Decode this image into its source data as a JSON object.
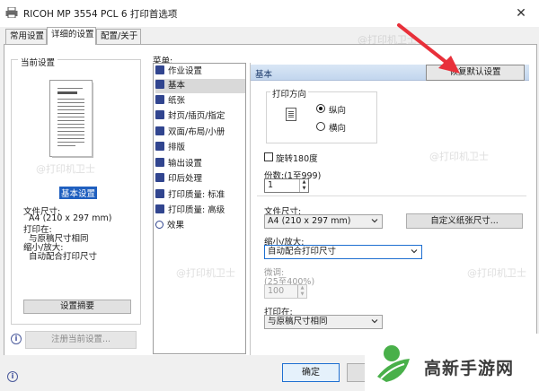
{
  "window": {
    "title": "RICOH MP 3554 PCL 6 打印首选项",
    "close_icon": "close-icon"
  },
  "tabs": [
    {
      "label": "常用设置"
    },
    {
      "label": "详细的设置"
    },
    {
      "label": "配置/关于"
    }
  ],
  "current_settings": {
    "legend": "当前设置",
    "selected_label": "基本设置",
    "lines": [
      "文件尺寸:",
      "A4 (210 x 297 mm)",
      "打印在:",
      "与原稿尺寸相同",
      "缩小/放大:",
      "自动配合打印尺寸"
    ],
    "summary_button": "设置摘要",
    "register_button": "注册当前设置..."
  },
  "menu": {
    "label": "菜单:",
    "items": [
      "作业设置",
      "基本",
      "纸张",
      "封页/插页/指定",
      "双面/布局/小册",
      "排版",
      "输出设置",
      "印后处理",
      "打印质量: 标准",
      "打印质量: 高级",
      "效果"
    ],
    "selected_index": 1
  },
  "panel": {
    "header": "基本",
    "restore_button": "恢复默认设置",
    "orientation": {
      "legend": "打印方向",
      "options": [
        "纵向",
        "横向"
      ],
      "selected_index": 0
    },
    "rotate": {
      "label": "旋转180度",
      "checked": false
    },
    "copies": {
      "label": "份数:(1至999)",
      "value": "1"
    },
    "paper_size": {
      "label": "文件尺寸:",
      "value": "A4 (210 x 297 mm)",
      "custom_button": "自定义纸张尺寸..."
    },
    "reduce_enlarge": {
      "label": "缩小/放大:",
      "value": "自动配合打印尺寸"
    },
    "fine_tune": {
      "label": "微调:",
      "range": "(25至400%)",
      "value": "100"
    },
    "print_on": {
      "label": "打印在:",
      "value": "与原稿尺寸相同"
    }
  },
  "footer": {
    "ok_button": "确定"
  },
  "watermark": "@打印机卫士",
  "logo": {
    "text": "高新手游网"
  },
  "colors": {
    "accent": "#1e6fd1",
    "selection": "#1f5fbf",
    "arrow": "#e8303a",
    "logo_green": "#49b04a"
  }
}
